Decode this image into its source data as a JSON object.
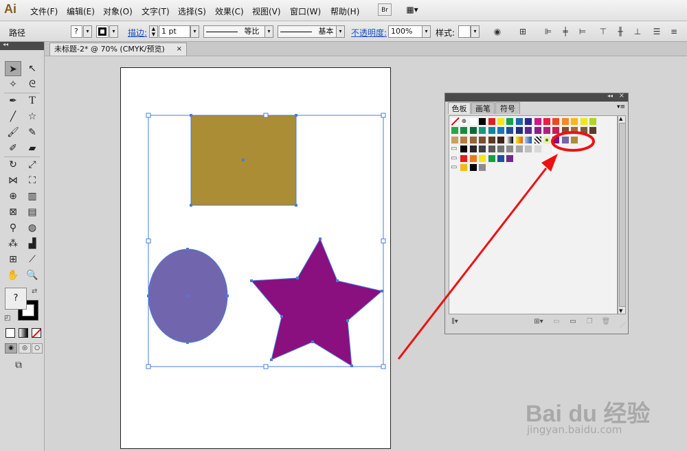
{
  "app": {
    "logo": "Ai"
  },
  "menu": [
    {
      "label": "文件(F)"
    },
    {
      "label": "编辑(E)"
    },
    {
      "label": "对象(O)"
    },
    {
      "label": "文字(T)"
    },
    {
      "label": "选择(S)"
    },
    {
      "label": "效果(C)"
    },
    {
      "label": "视图(V)"
    },
    {
      "label": "窗口(W)"
    },
    {
      "label": "帮助(H)"
    }
  ],
  "menubar_buttons": {
    "bridge": "Br",
    "arrange": "▦▾"
  },
  "control": {
    "object_type": "路径",
    "fill_value": "?",
    "stroke_label": "描边:",
    "stroke_weight": "1 pt",
    "profile": "等比",
    "brush": "基本",
    "opacity_label": "不透明度:",
    "opacity_value": "100%",
    "style_label": "样式:"
  },
  "document": {
    "tab_title": "未标题-2* @ 70% (CMYK/预览)",
    "close_glyph": "×"
  },
  "toolbar": {
    "fill_question": "?"
  },
  "panel": {
    "tabs": [
      {
        "label": "色板"
      },
      {
        "label": "画笔"
      },
      {
        "label": "符号"
      }
    ],
    "menu_glyph": "▾≡",
    "collapse_glyph": "◂◂",
    "close_glyph": "×"
  },
  "shapes": {
    "rectangle_color": "#ab8d35",
    "ellipse_color": "#7166ae",
    "star_color": "#8a0f7f",
    "selection_color": "#4a7bd8",
    "annotation_color": "#ee1111"
  },
  "watermark": {
    "main": "Bai du 经验",
    "sub": "jingyan.baidu.com"
  }
}
